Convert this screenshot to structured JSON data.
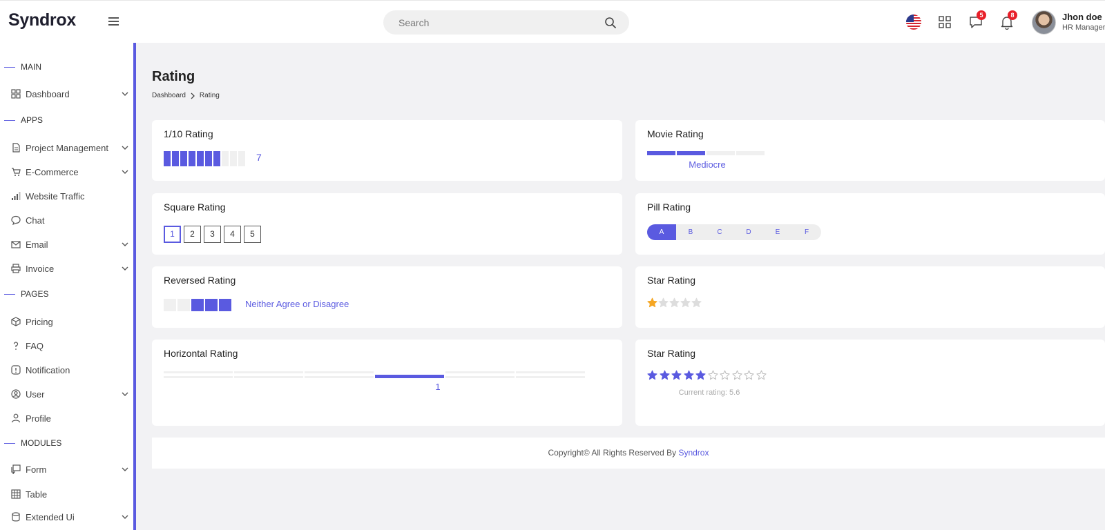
{
  "header": {
    "brand": "Syndrox",
    "search_placeholder": "Search",
    "messages_badge": "5",
    "notifications_badge": "8",
    "user_name": "Jhon doe",
    "user_role": "HR Manager"
  },
  "sidebar": {
    "sections": {
      "main": "MAIN",
      "apps": "APPS",
      "pages": "PAGES",
      "modules": "MODULES"
    },
    "items": {
      "dashboard": "Dashboard",
      "project_management": "Project Management",
      "ecommerce": "E-Commerce",
      "website_traffic": "Website Traffic",
      "chat": "Chat",
      "email": "Email",
      "invoice": "Invoice",
      "pricing": "Pricing",
      "faq": "FAQ",
      "notification": "Notification",
      "user": "User",
      "profile": "Profile",
      "form": "Form",
      "table": "Table",
      "extended_ui": "Extended Ui"
    }
  },
  "page": {
    "title": "Rating",
    "breadcrumb": [
      "Dashboard",
      "Rating"
    ]
  },
  "cards": {
    "ten_rating": {
      "title": "1/10 Rating",
      "value": 7,
      "value_label": "7",
      "max": 10
    },
    "movie_rating": {
      "title": "Movie Rating",
      "value": 2,
      "max": 4,
      "label": "Mediocre"
    },
    "square_rating": {
      "title": "Square Rating",
      "options": [
        "1",
        "2",
        "3",
        "4",
        "5"
      ],
      "selected": "1"
    },
    "pill_rating": {
      "title": "Pill Rating",
      "options": [
        "A",
        "B",
        "C",
        "D",
        "E",
        "F"
      ],
      "selected": "A"
    },
    "reversed_rating": {
      "title": "Reversed Rating",
      "value": 3,
      "max": 5,
      "label": "Neither Agree or Disagree"
    },
    "star_rating": {
      "title": "Star Rating",
      "value": 1,
      "max": 5
    },
    "horizontal_rating": {
      "title": "Horizontal Rating",
      "value": 4,
      "max": 6,
      "label": "1"
    },
    "star_rating_10": {
      "title": "Star Rating",
      "value": 5,
      "max": 10,
      "status": "Current rating: 5.6"
    }
  },
  "footer": {
    "text": "Copyright© All Rights Reserved By ",
    "link": "Syndrox"
  },
  "colors": {
    "accent": "#5a5ae0",
    "star_gold": "#f5a623",
    "inactive": "#f0f0f0",
    "badge": "#e8202a"
  }
}
